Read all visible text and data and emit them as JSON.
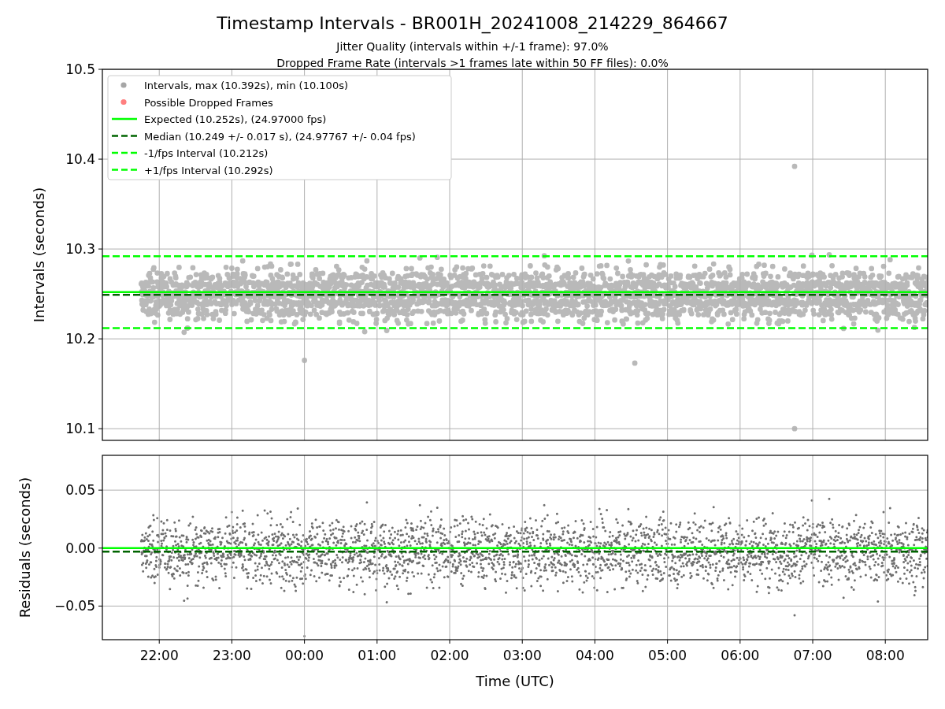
{
  "figure": {
    "title": "Timestamp Intervals - BR001H_20241008_214229_864667",
    "subtitle_lines": [
      "Jitter Quality (intervals within +/-1 frame): 97.0%",
      "Dropped Frame Rate (intervals >1 frames late within 50 FF files): 0.0%"
    ],
    "xlabel": "Time (UTC)"
  },
  "intervals_panel": {
    "legend_markers": [
      {
        "label": "Intervals, max (10.392s), min (10.100s)",
        "color": "#a6a6a6"
      },
      {
        "label": "Possible Dropped Frames",
        "color": "#ff7f7f"
      }
    ],
    "chart_data": {
      "type": "line",
      "ylabel": "Intervals (seconds)",
      "grid": true,
      "xlim": [
        "2024-10-08T21:13",
        "2024-10-09T08:35"
      ],
      "ylim": [
        10.087,
        10.5
      ],
      "yticks": [
        10.1,
        10.2,
        10.3,
        10.4,
        10.5
      ],
      "x": [
        "2024-10-08T21:13",
        "2024-10-09T08:35"
      ],
      "series": [
        {
          "name": "Expected (10.252s), (24.97000 fps)",
          "color": "#00ff00",
          "line_style": "solid",
          "values": [
            10.252,
            10.252
          ]
        },
        {
          "name": "Median (10.249 +/- 0.017 s), (24.97767 +/- 0.04 fps)",
          "color": "#006400",
          "line_style": "dashed",
          "values": [
            10.249,
            10.249
          ]
        },
        {
          "name": "-1/fps Interval (10.212s)",
          "color": "#00ff00",
          "line_style": "dashed",
          "values": [
            10.212,
            10.212
          ]
        },
        {
          "name": "+1/fps Interval (10.292s)",
          "color": "#00ff00",
          "line_style": "dashed",
          "values": [
            10.292,
            10.292
          ]
        }
      ]
    }
  },
  "residuals_panel": {
    "chart_data": {
      "type": "line",
      "ylabel": "Residuals (seconds)",
      "grid": true,
      "xlim": [
        "2024-10-08T21:13",
        "2024-10-09T08:35"
      ],
      "ylim": [
        -0.079,
        0.08
      ],
      "yticks": [
        {
          "value": 0.05,
          "label": "0.05"
        },
        {
          "value": 0,
          "label": "0.00"
        },
        {
          "value": -0.05,
          "label": "−0.05"
        }
      ],
      "xticks": [
        {
          "value": "2024-10-08T22:00",
          "label": "22:00"
        },
        {
          "value": "2024-10-08T23:00",
          "label": "23:00"
        },
        {
          "value": "2024-10-09T00:00",
          "label": "00:00"
        },
        {
          "value": "2024-10-09T01:00",
          "label": "01:00"
        },
        {
          "value": "2024-10-09T02:00",
          "label": "02:00"
        },
        {
          "value": "2024-10-09T03:00",
          "label": "03:00"
        },
        {
          "value": "2024-10-09T04:00",
          "label": "04:00"
        },
        {
          "value": "2024-10-09T05:00",
          "label": "05:00"
        },
        {
          "value": "2024-10-09T06:00",
          "label": "06:00"
        },
        {
          "value": "2024-10-09T07:00",
          "label": "07:00"
        },
        {
          "value": "2024-10-09T08:00",
          "label": "08:00"
        }
      ],
      "x": [
        "2024-10-08T21:13",
        "2024-10-09T08:35"
      ],
      "series": [
        {
          "color": "#00ff00",
          "line_style": "solid",
          "values": [
            0,
            0
          ]
        },
        {
          "color": "#006400",
          "line_style": "dashed",
          "values": [
            -0.003,
            -0.003
          ]
        }
      ]
    }
  }
}
